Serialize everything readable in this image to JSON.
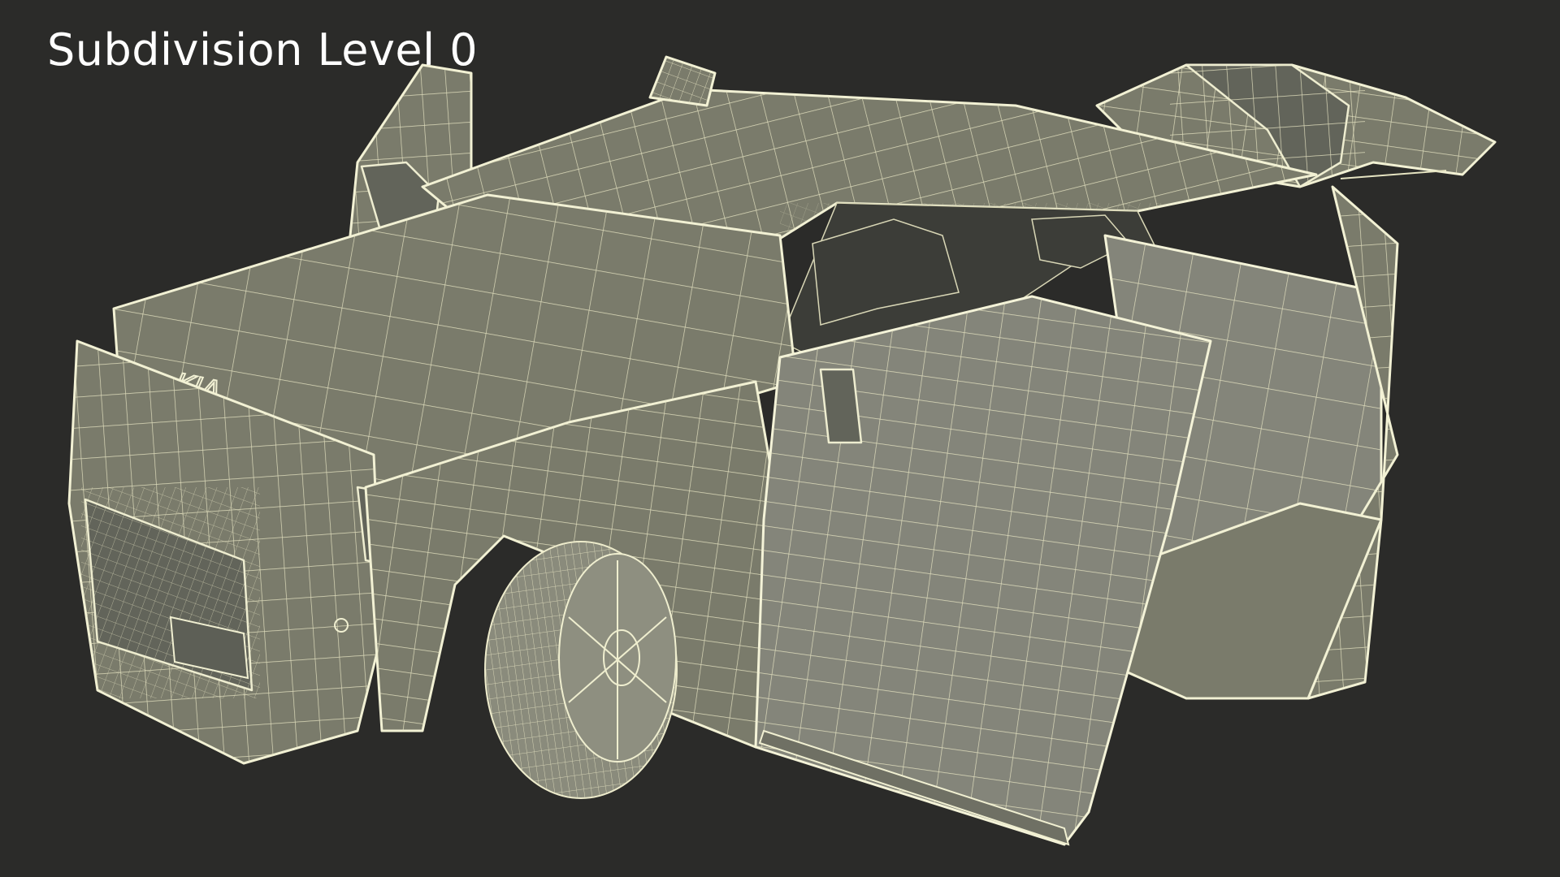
{
  "viewport": {
    "background": "#2b2b29",
    "caption": "Subdivision Level 0",
    "caption_color": "#ffffff"
  },
  "model": {
    "description_icon": "car-wireframe-icon",
    "badge_text": "KIA",
    "mesh_fill": "#7a7b6b",
    "wire_color": "#f2f1d4"
  }
}
